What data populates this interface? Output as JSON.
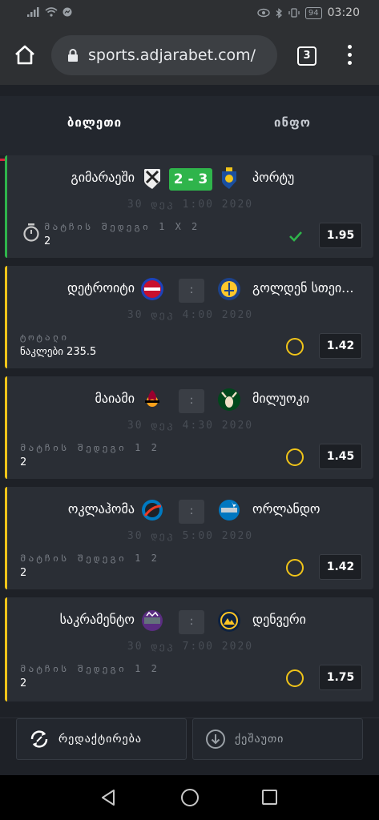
{
  "status_bar": {
    "battery": "94",
    "time": "03:20"
  },
  "browser": {
    "url": "sports.adjarabet.com/",
    "tab_count": "3"
  },
  "tabs": [
    {
      "label": "ბილეთი",
      "active": true
    },
    {
      "label": "ინფო",
      "active": false
    }
  ],
  "bets": [
    {
      "home": "გიმარაეში",
      "away": "პორტუ",
      "score": "2 - 3",
      "date": "30 დეკ 1:00 2020",
      "market": "მატჩის შედეგი 1 X 2",
      "selection": "2",
      "odd": "1.95",
      "status": "won"
    },
    {
      "home": "დეტროიტი",
      "away": "გოლდენ სთეი...",
      "score": ":",
      "date": "30 დეკ 4:00 2020",
      "market": "ტოტალი",
      "selection": "ნაკლები 235.5",
      "odd": "1.42",
      "status": "pending"
    },
    {
      "home": "მაიამი",
      "away": "მილუოკი",
      "score": ":",
      "date": "30 დეკ 4:30 2020",
      "market": "მატჩის შედეგი 1 2",
      "selection": "2",
      "odd": "1.45",
      "status": "pending"
    },
    {
      "home": "ოკლაჰომა",
      "away": "ორლანდო",
      "score": ":",
      "date": "30 დეკ 5:00 2020",
      "market": "მატჩის შედეგი 1 2",
      "selection": "2",
      "odd": "1.42",
      "status": "pending"
    },
    {
      "home": "საკრამენტო",
      "away": "დენვერი",
      "score": ":",
      "date": "30 დეკ 7:00 2020",
      "market": "მატჩის შედეგი 1 2",
      "selection": "2",
      "odd": "1.75",
      "status": "pending"
    }
  ],
  "actions": {
    "edit_label": "რედაქტირება",
    "share_label": "ქეშაუთი"
  },
  "colors": {
    "accent_red": "#d8223b",
    "win_green": "#2fb44b",
    "pending_yellow": "#f0c419",
    "card_bg": "#2a2e35"
  }
}
